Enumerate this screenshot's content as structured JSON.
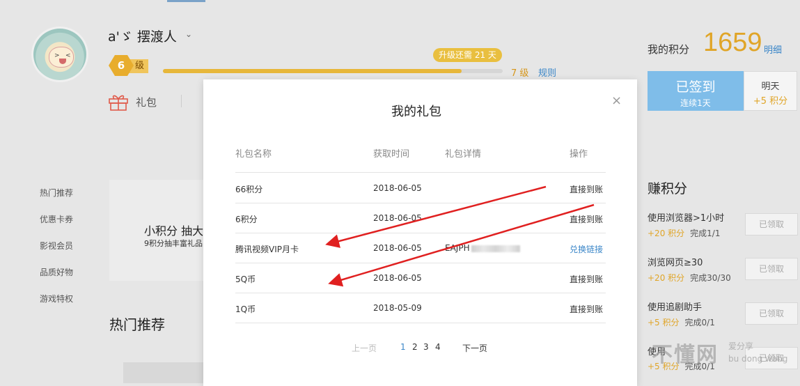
{
  "profile": {
    "username": "a'ゞ 摆渡人",
    "level": "6",
    "level_suffix": "级",
    "upgrade_tip": "升级还需 21 天",
    "progress": 0.88,
    "next_level": "7 级",
    "rules_link": "规则",
    "gift_label": "礼包"
  },
  "points": {
    "label": "我的积分",
    "value": "1659",
    "detail_link": "明细",
    "signed_main": "已签到",
    "signed_sub": "连续1天",
    "tomorrow_label": "明天",
    "tomorrow_points": "+5 积分"
  },
  "sidebar": {
    "items": [
      {
        "label": "热门推荐"
      },
      {
        "label": "优惠卡券"
      },
      {
        "label": "影视会员"
      },
      {
        "label": "品质好物"
      },
      {
        "label": "游戏特权"
      }
    ]
  },
  "banner": {
    "title": "小积分 抽大",
    "subtitle": "9积分抽丰富礼品"
  },
  "hot_section_title": "热门推荐",
  "earn": {
    "title": "赚积分",
    "tasks": [
      {
        "name": "使用浏览器>1小时",
        "points": "+20 积分",
        "progress": "完成1/1",
        "button": "已领取"
      },
      {
        "name": "浏览网页≥30",
        "points": "+20 积分",
        "progress": "完成30/30",
        "button": "已领取"
      },
      {
        "name": "使用追剧助手",
        "points": "+5 积分",
        "progress": "完成0/1",
        "button": "已领取"
      },
      {
        "name": "使用",
        "points": "+5 积分",
        "progress": "完成0/1",
        "button": "已领取"
      }
    ]
  },
  "watermark": {
    "text": "不懂网",
    "sub1": "爱分享",
    "sub2": "bu dong wang"
  },
  "modal": {
    "title": "我的礼包",
    "close_icon": "×",
    "headers": {
      "name": "礼包名称",
      "time": "获取时间",
      "detail": "礼包详情",
      "action": "操作"
    },
    "rows": [
      {
        "name": "66积分",
        "time": "2018-06-05",
        "detail": "",
        "action": "直接到账",
        "action_is_link": false
      },
      {
        "name": "6积分",
        "time": "2018-06-05",
        "detail": "",
        "action": "直接到账",
        "action_is_link": false
      },
      {
        "name": "腾讯视频VIP月卡",
        "time": "2018-06-05",
        "detail": "EAJPH",
        "action": "兑换链接",
        "action_is_link": true
      },
      {
        "name": "5Q币",
        "time": "2018-06-05",
        "detail": "",
        "action": "直接到账",
        "action_is_link": false
      },
      {
        "name": "1Q币",
        "time": "2018-05-09",
        "detail": "",
        "action": "直接到账",
        "action_is_link": false
      }
    ],
    "pager": {
      "prev": "上一页",
      "pages": [
        "1",
        "2",
        "3",
        "4"
      ],
      "current": "1",
      "next": "下一页"
    }
  },
  "colors": {
    "accent_gold": "#e0a528",
    "link_blue": "#3a86c8",
    "signed_blue": "#7fbde9",
    "annotation_red": "#e02020"
  }
}
